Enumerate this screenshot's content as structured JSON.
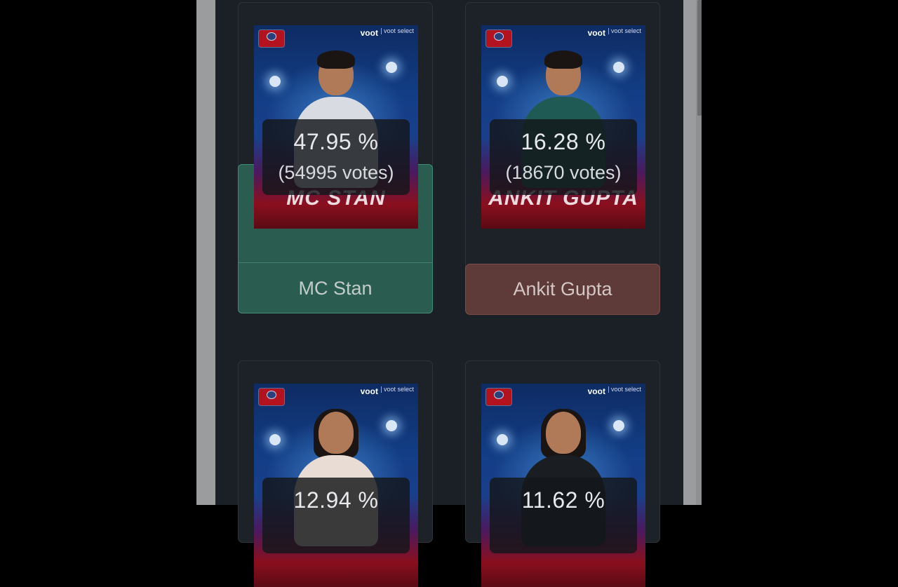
{
  "contestants": [
    {
      "name": "MC Stan",
      "percent": "47.95 %",
      "votes": "(54995 votes)",
      "poster_name": "MC STAN",
      "state": "selected"
    },
    {
      "name": "Ankit Gupta",
      "percent": "16.28 %",
      "votes": "(18670 votes)",
      "poster_name": "ANKIT GUPTA",
      "state": "lost"
    },
    {
      "name": "",
      "percent": "12.94 %",
      "votes": "",
      "poster_name": "",
      "state": "normal"
    },
    {
      "name": "",
      "percent": "11.62 %",
      "votes": "",
      "poster_name": "",
      "state": "normal"
    }
  ],
  "brand": {
    "voot": "voot",
    "select": "voot select"
  },
  "colors": {
    "page_bg": "#1b2026",
    "selected_green": "#2e6e5c",
    "lost_red": "#5e3a38",
    "overlay_text": "#e7e9ec"
  }
}
